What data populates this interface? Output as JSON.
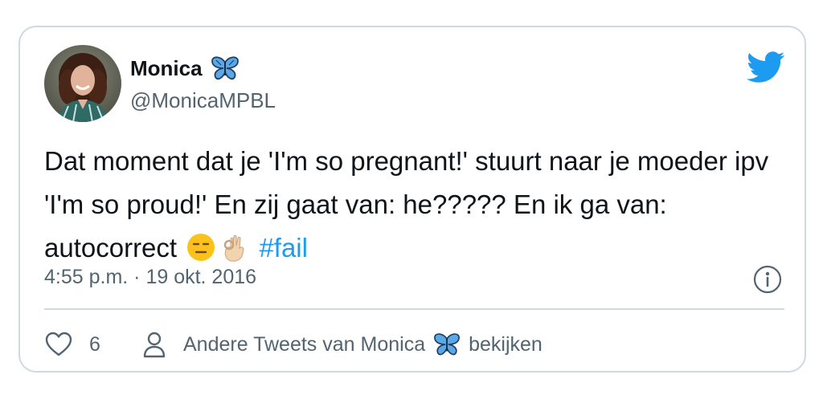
{
  "author": {
    "display_name": "Monica",
    "handle": "@MonicaMPBL",
    "avatar": "avatar-photo",
    "name_emoji": "butterfly-icon"
  },
  "tweet": {
    "text_part1": "Dat moment dat je 'I'm so pregnant!' stuurt naar je moeder ipv 'I'm so proud!' En zij gaat van: he????? En ik ga van: autocorrect",
    "emojis": [
      "expressionless-face-icon",
      "ok-hand-icon"
    ],
    "hashtag": "#fail",
    "timestamp": "4:55 p.m. · 19 okt. 2016"
  },
  "actions": {
    "like_count": "6",
    "more_tweets_prefix": "Andere Tweets van Monica",
    "more_tweets_suffix": "bekijken"
  },
  "colors": {
    "accent": "#1d9bf0",
    "text": "#0f1419",
    "secondary_text": "#536471",
    "border": "#cfd9de"
  },
  "icons": {
    "logo": "twitter-bird-icon",
    "info": "info-icon",
    "like": "heart-icon",
    "profile": "person-icon"
  }
}
